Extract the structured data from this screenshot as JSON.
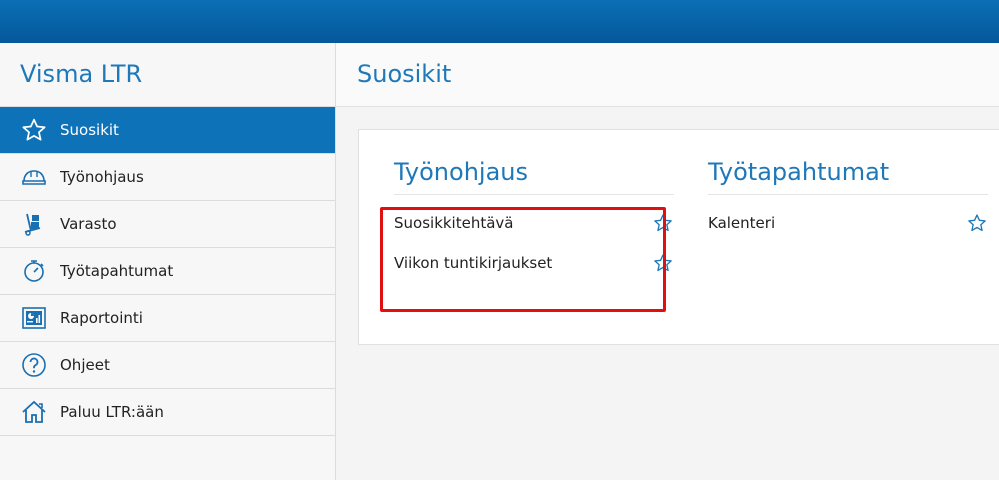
{
  "app": {
    "title": "Visma LTR"
  },
  "sidebar": {
    "items": [
      {
        "label": "Suosikit",
        "icon": "star-icon",
        "active": true
      },
      {
        "label": "Työnohjaus",
        "icon": "hardhat-icon"
      },
      {
        "label": "Varasto",
        "icon": "handtruck-icon"
      },
      {
        "label": "Työtapahtumat",
        "icon": "stopwatch-icon"
      },
      {
        "label": "Raportointi",
        "icon": "report-icon"
      },
      {
        "label": "Ohjeet",
        "icon": "help-icon"
      },
      {
        "label": "Paluu LTR:ään",
        "icon": "home-icon"
      }
    ]
  },
  "main": {
    "title": "Suosikit",
    "sections": [
      {
        "title": "Työnohjaus",
        "items": [
          {
            "label": "Suosikkitehtävä"
          },
          {
            "label": "Viikon tuntikirjaukset"
          }
        ]
      },
      {
        "title": "Työtapahtumat",
        "items": [
          {
            "label": "Kalenteri"
          }
        ]
      }
    ]
  },
  "colors": {
    "accent": "#1f78b8",
    "topbar": "#0b6fb5",
    "active": "#0e72b9",
    "highlight": "#e01010"
  }
}
